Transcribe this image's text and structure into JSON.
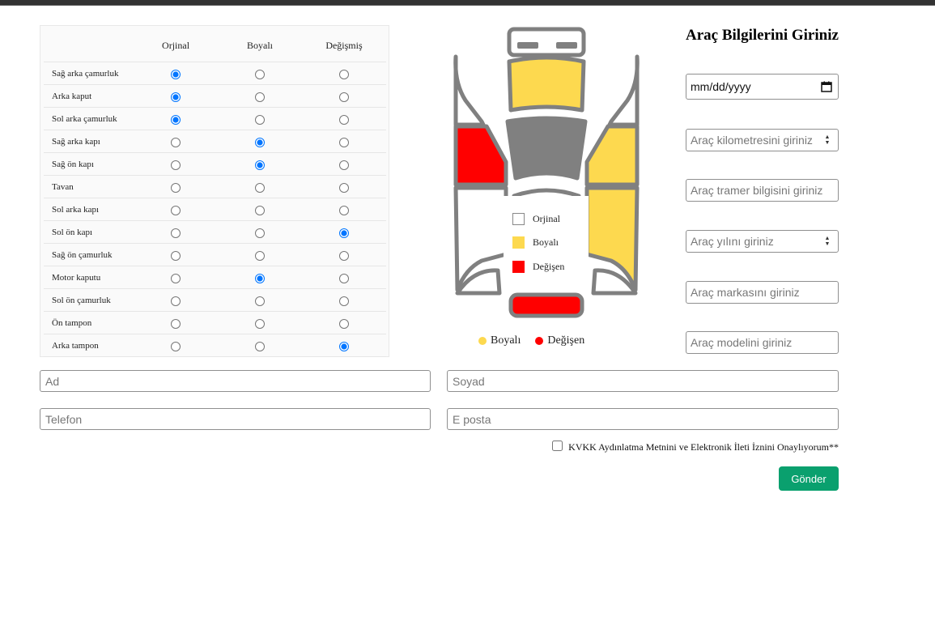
{
  "parts": {
    "headers": [
      "Orjinal",
      "Boyalı",
      "Değişmiş"
    ],
    "rows": [
      {
        "name": "Sağ arka çamurluk",
        "selected": 0
      },
      {
        "name": "Arka kaput",
        "selected": 0
      },
      {
        "name": "Sol arka çamurluk",
        "selected": 0
      },
      {
        "name": "Sağ arka kapı",
        "selected": 1
      },
      {
        "name": "Sağ ön kapı",
        "selected": 1
      },
      {
        "name": "Tavan",
        "selected": -1
      },
      {
        "name": "Sol arka kapı",
        "selected": -1
      },
      {
        "name": "Sol ön kapı",
        "selected": 2
      },
      {
        "name": "Sağ ön çamurluk",
        "selected": -1
      },
      {
        "name": "Motor kaputu",
        "selected": 1
      },
      {
        "name": "Sol ön çamurluk",
        "selected": -1
      },
      {
        "name": "Ön tampon",
        "selected": -1
      },
      {
        "name": "Arka tampon",
        "selected": 2
      }
    ]
  },
  "car_legend": {
    "original": "Orjinal",
    "painted": "Boyalı",
    "changed": "Değişen"
  },
  "summary_legend": {
    "painted": "Boyalı",
    "changed": "Değişen"
  },
  "colors": {
    "original": "#ffffff",
    "painted": "#fdd94f",
    "changed": "#ff0000",
    "body_gray": "#808080",
    "button_green": "#0aa06e"
  },
  "form": {
    "title": "Araç Bilgilerini Giriniz",
    "date_placeholder": "mm/dd/yyyy",
    "km_placeholder": "Araç kilometresini giriniz",
    "tramer_placeholder": "Araç tramer bilgisini giriniz",
    "year_placeholder": "Araç yılını giriniz",
    "brand_placeholder": "Araç markasını giriniz",
    "model_placeholder": "Araç modelini giriniz"
  },
  "contact": {
    "first_name_placeholder": "Ad",
    "last_name_placeholder": "Soyad",
    "phone_placeholder": "Telefon",
    "email_placeholder": "E posta",
    "consent_label": "KVKK Aydınlatma Metnini ve Elektronik İleti İznini Onaylıyorum**",
    "submit_label": "Gönder"
  },
  "icons": {
    "calendar": "calendar-icon",
    "spinner": "number-spinner-icon"
  }
}
